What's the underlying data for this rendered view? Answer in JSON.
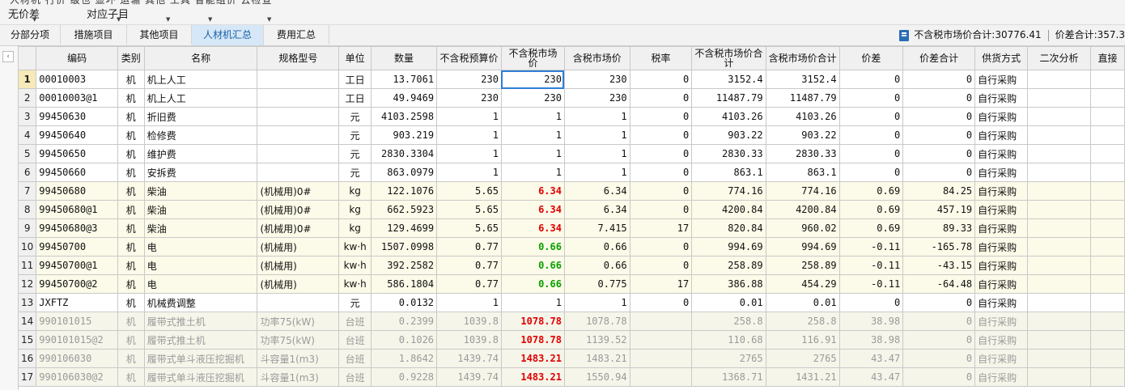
{
  "toolbar": {
    "cut_text": "人材机   行价         级也   显坏   运输   其他       工具       智能组价  云检查",
    "btn1": "无价差",
    "btn2": "对应子目"
  },
  "tabs": [
    "分部分项",
    "措施项目",
    "其他项目",
    "人材机汇总",
    "费用汇总"
  ],
  "active_tab": 3,
  "summary": {
    "excl_tax_total": "不含税市场价合计:30776.41",
    "diff_total": "价差合计:357.3"
  },
  "columns": [
    "",
    "编码",
    "类别",
    "名称",
    "规格型号",
    "单位",
    "数量",
    "不含税预算价",
    "不含税市场价",
    "含税市场价",
    "税率",
    "不含税市场价合计",
    "含税市场价合计",
    "价差",
    "价差合计",
    "供货方式",
    "二次分析",
    "直接"
  ],
  "rows": [
    {
      "n": "1",
      "code": "00010003",
      "cat": "机",
      "name": "机上人工",
      "spec": "",
      "unit": "工日",
      "qty": "13.7061",
      "budget": "230",
      "mkt": "230",
      "taxmkt": "230",
      "rate": "0",
      "sum1": "3152.4",
      "sum2": "3152.4",
      "diff": "0",
      "diffsum": "0",
      "supply": "自行采购",
      "style": "white",
      "mkt_style": "sel"
    },
    {
      "n": "2",
      "code": "00010003@1",
      "cat": "机",
      "name": "机上人工",
      "spec": "",
      "unit": "工日",
      "qty": "49.9469",
      "budget": "230",
      "mkt": "230",
      "taxmkt": "230",
      "rate": "0",
      "sum1": "11487.79",
      "sum2": "11487.79",
      "diff": "0",
      "diffsum": "0",
      "supply": "自行采购",
      "style": "white",
      "mkt_style": ""
    },
    {
      "n": "3",
      "code": "99450630",
      "cat": "机",
      "name": "折旧费",
      "spec": "",
      "unit": "元",
      "qty": "4103.2598",
      "budget": "1",
      "mkt": "1",
      "taxmkt": "1",
      "rate": "0",
      "sum1": "4103.26",
      "sum2": "4103.26",
      "diff": "0",
      "diffsum": "0",
      "supply": "自行采购",
      "style": "white",
      "mkt_style": ""
    },
    {
      "n": "4",
      "code": "99450640",
      "cat": "机",
      "name": "检修费",
      "spec": "",
      "unit": "元",
      "qty": "903.219",
      "budget": "1",
      "mkt": "1",
      "taxmkt": "1",
      "rate": "0",
      "sum1": "903.22",
      "sum2": "903.22",
      "diff": "0",
      "diffsum": "0",
      "supply": "自行采购",
      "style": "white",
      "mkt_style": ""
    },
    {
      "n": "5",
      "code": "99450650",
      "cat": "机",
      "name": "维护费",
      "spec": "",
      "unit": "元",
      "qty": "2830.3304",
      "budget": "1",
      "mkt": "1",
      "taxmkt": "1",
      "rate": "0",
      "sum1": "2830.33",
      "sum2": "2830.33",
      "diff": "0",
      "diffsum": "0",
      "supply": "自行采购",
      "style": "white",
      "mkt_style": ""
    },
    {
      "n": "6",
      "code": "99450660",
      "cat": "机",
      "name": "安拆费",
      "spec": "",
      "unit": "元",
      "qty": "863.0979",
      "budget": "1",
      "mkt": "1",
      "taxmkt": "1",
      "rate": "0",
      "sum1": "863.1",
      "sum2": "863.1",
      "diff": "0",
      "diffsum": "0",
      "supply": "自行采购",
      "style": "white",
      "mkt_style": ""
    },
    {
      "n": "7",
      "code": "99450680",
      "cat": "机",
      "name": "柴油",
      "spec": "(机械用)0#",
      "unit": "kg",
      "qty": "122.1076",
      "budget": "5.65",
      "mkt": "6.34",
      "taxmkt": "6.34",
      "rate": "0",
      "sum1": "774.16",
      "sum2": "774.16",
      "diff": "0.69",
      "diffsum": "84.25",
      "supply": "自行采购",
      "style": "yellow",
      "mkt_style": "red"
    },
    {
      "n": "8",
      "code": "99450680@1",
      "cat": "机",
      "name": "柴油",
      "spec": "(机械用)0#",
      "unit": "kg",
      "qty": "662.5923",
      "budget": "5.65",
      "mkt": "6.34",
      "taxmkt": "6.34",
      "rate": "0",
      "sum1": "4200.84",
      "sum2": "4200.84",
      "diff": "0.69",
      "diffsum": "457.19",
      "supply": "自行采购",
      "style": "yellow",
      "mkt_style": "red"
    },
    {
      "n": "9",
      "code": "99450680@3",
      "cat": "机",
      "name": "柴油",
      "spec": "(机械用)0#",
      "unit": "kg",
      "qty": "129.4699",
      "budget": "5.65",
      "mkt": "6.34",
      "taxmkt": "7.415",
      "rate": "17",
      "sum1": "820.84",
      "sum2": "960.02",
      "diff": "0.69",
      "diffsum": "89.33",
      "supply": "自行采购",
      "style": "yellow",
      "mkt_style": "red"
    },
    {
      "n": "10",
      "code": "99450700",
      "cat": "机",
      "name": "电",
      "spec": "(机械用)",
      "unit": "kw·h",
      "qty": "1507.0998",
      "budget": "0.77",
      "mkt": "0.66",
      "taxmkt": "0.66",
      "rate": "0",
      "sum1": "994.69",
      "sum2": "994.69",
      "diff": "-0.11",
      "diffsum": "-165.78",
      "supply": "自行采购",
      "style": "yellow",
      "mkt_style": "green"
    },
    {
      "n": "11",
      "code": "99450700@1",
      "cat": "机",
      "name": "电",
      "spec": "(机械用)",
      "unit": "kw·h",
      "qty": "392.2582",
      "budget": "0.77",
      "mkt": "0.66",
      "taxmkt": "0.66",
      "rate": "0",
      "sum1": "258.89",
      "sum2": "258.89",
      "diff": "-0.11",
      "diffsum": "-43.15",
      "supply": "自行采购",
      "style": "yellow",
      "mkt_style": "green"
    },
    {
      "n": "12",
      "code": "99450700@2",
      "cat": "机",
      "name": "电",
      "spec": "(机械用)",
      "unit": "kw·h",
      "qty": "586.1804",
      "budget": "0.77",
      "mkt": "0.66",
      "taxmkt": "0.775",
      "rate": "17",
      "sum1": "386.88",
      "sum2": "454.29",
      "diff": "-0.11",
      "diffsum": "-64.48",
      "supply": "自行采购",
      "style": "yellow",
      "mkt_style": "green"
    },
    {
      "n": "13",
      "code": "JXFTZ",
      "cat": "机",
      "name": "机械费调整",
      "spec": "",
      "unit": "元",
      "qty": "0.0132",
      "budget": "1",
      "mkt": "1",
      "taxmkt": "1",
      "rate": "0",
      "sum1": "0.01",
      "sum2": "0.01",
      "diff": "0",
      "diffsum": "0",
      "supply": "自行采购",
      "style": "white",
      "mkt_style": ""
    },
    {
      "n": "14",
      "code": "990101015",
      "cat": "机",
      "name": "履带式推土机",
      "spec": "功率75(kW)",
      "unit": "台班",
      "qty": "0.2399",
      "budget": "1039.8",
      "mkt": "1078.78",
      "taxmkt": "1078.78",
      "rate": "",
      "sum1": "258.8",
      "sum2": "258.8",
      "diff": "38.98",
      "diffsum": "0",
      "supply": "自行采购",
      "style": "grey",
      "mkt_style": ""
    },
    {
      "n": "15",
      "code": "990101015@2",
      "cat": "机",
      "name": "履带式推土机",
      "spec": "功率75(kW)",
      "unit": "台班",
      "qty": "0.1026",
      "budget": "1039.8",
      "mkt": "1078.78",
      "taxmkt": "1139.52",
      "rate": "",
      "sum1": "110.68",
      "sum2": "116.91",
      "diff": "38.98",
      "diffsum": "0",
      "supply": "自行采购",
      "style": "grey",
      "mkt_style": ""
    },
    {
      "n": "16",
      "code": "990106030",
      "cat": "机",
      "name": "履带式单斗液压挖掘机",
      "spec": "斗容量1(m3)",
      "unit": "台班",
      "qty": "1.8642",
      "budget": "1439.74",
      "mkt": "1483.21",
      "taxmkt": "1483.21",
      "rate": "",
      "sum1": "2765",
      "sum2": "2765",
      "diff": "43.47",
      "diffsum": "0",
      "supply": "自行采购",
      "style": "grey",
      "mkt_style": ""
    },
    {
      "n": "17",
      "code": "990106030@2",
      "cat": "机",
      "name": "履带式单斗液压挖掘机",
      "spec": "斗容量1(m3)",
      "unit": "台班",
      "qty": "0.9228",
      "budget": "1439.74",
      "mkt": "1483.21",
      "taxmkt": "1550.94",
      "rate": "",
      "sum1": "1368.71",
      "sum2": "1431.21",
      "diff": "43.47",
      "diffsum": "0",
      "supply": "自行采购",
      "style": "grey",
      "mkt_style": ""
    }
  ]
}
